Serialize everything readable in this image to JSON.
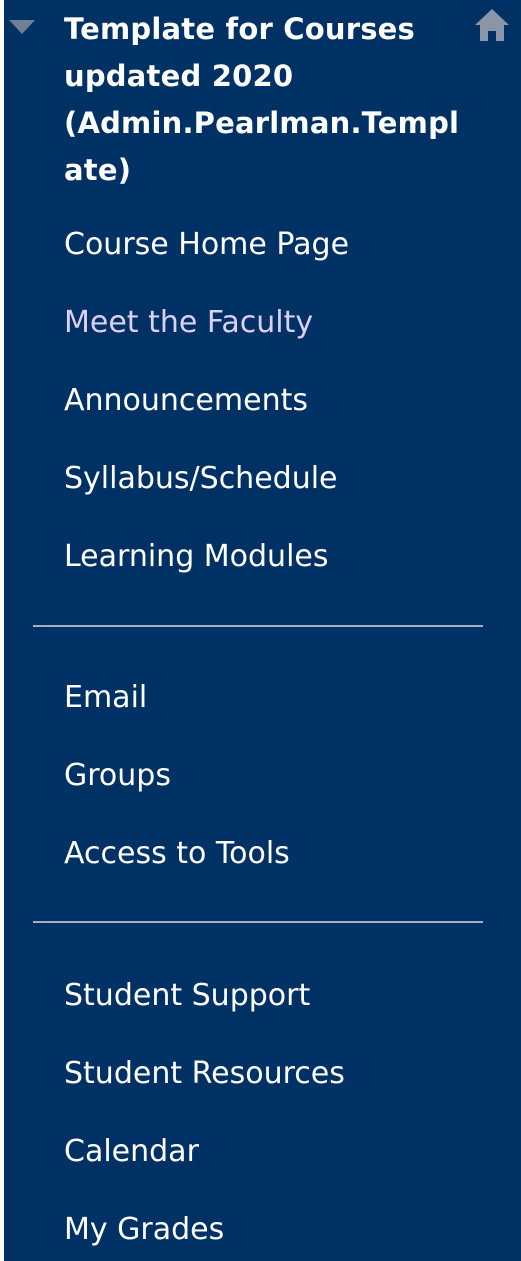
{
  "course": {
    "title_lines": [
      "Template for Courses",
      "updated 2020",
      "(Admin.Pearlman.Templ",
      "ate)"
    ]
  },
  "icons": {
    "collapse": "triangle-down-icon",
    "home": "home-icon"
  },
  "colors": {
    "menu_background": "#003164",
    "link_text": "#ffffff",
    "visited_link_text": "#dccff1",
    "toggle_icon": "#6f7f96",
    "home_icon": "#8a96a8",
    "divider": "#a6b0c2"
  },
  "menu": {
    "section_1": [
      {
        "label": "Course Home Page"
      },
      {
        "label": "Meet the Faculty"
      },
      {
        "label": "Announcements"
      },
      {
        "label": "Syllabus/Schedule"
      },
      {
        "label": "Learning Modules"
      }
    ],
    "section_2": [
      {
        "label": "Email"
      },
      {
        "label": "Groups"
      },
      {
        "label": "Access to Tools"
      }
    ],
    "section_3": [
      {
        "label": "Student Support"
      },
      {
        "label": "Student Resources"
      },
      {
        "label": "Calendar"
      },
      {
        "label": "My Grades"
      }
    ]
  }
}
